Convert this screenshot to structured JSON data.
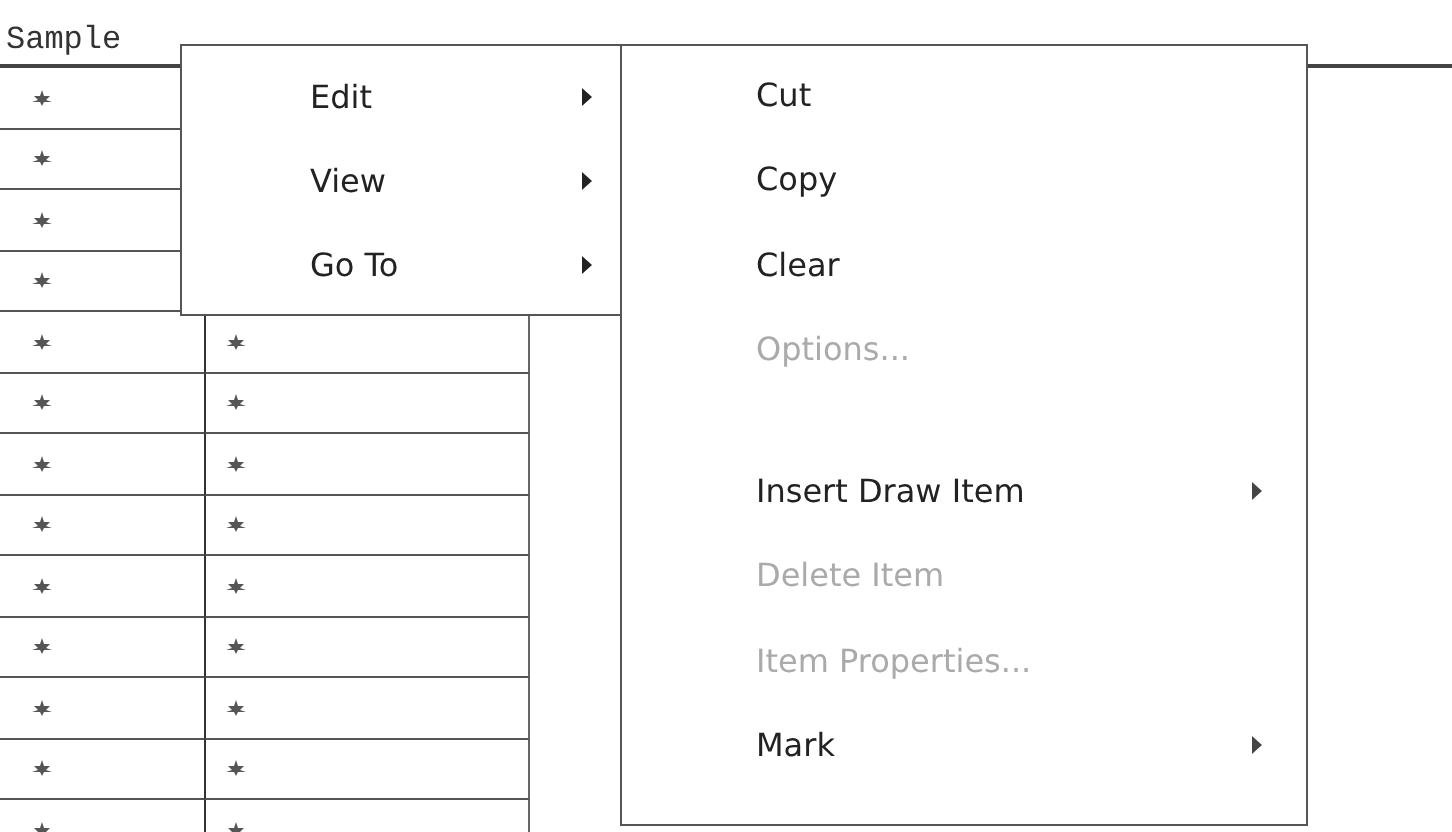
{
  "table": {
    "columns": [
      {
        "label": "Sample"
      }
    ],
    "rows": [
      {
        "marked": true
      },
      {
        "marked": true
      },
      {
        "marked": true
      },
      {
        "marked": true
      },
      {
        "marked": true
      },
      {
        "marked": true
      },
      {
        "marked": true
      },
      {
        "marked": true
      },
      {
        "marked": true
      },
      {
        "marked": true
      },
      {
        "marked": true
      },
      {
        "marked": true
      },
      {
        "marked": true
      }
    ]
  },
  "context_menu": {
    "items": [
      {
        "label": "Edit",
        "has_submenu": true
      },
      {
        "label": "View",
        "has_submenu": true
      },
      {
        "label": "Go To",
        "has_submenu": true
      }
    ]
  },
  "submenu": {
    "items": [
      {
        "kind": "item",
        "label": "Cut",
        "disabled": false,
        "has_submenu": false
      },
      {
        "kind": "item",
        "label": "Copy",
        "disabled": false,
        "has_submenu": false
      },
      {
        "kind": "item",
        "label": "Clear",
        "disabled": false,
        "has_submenu": false
      },
      {
        "kind": "item",
        "label": "Options...",
        "disabled": true,
        "has_submenu": false
      },
      {
        "kind": "separator"
      },
      {
        "kind": "item",
        "label": "Insert Draw Item",
        "disabled": false,
        "has_submenu": true
      },
      {
        "kind": "item",
        "label": "Delete Item",
        "disabled": true,
        "has_submenu": false
      },
      {
        "kind": "item",
        "label": "Item Properties...",
        "disabled": true,
        "has_submenu": false
      },
      {
        "kind": "item",
        "label": "Mark",
        "disabled": false,
        "has_submenu": true
      }
    ]
  }
}
